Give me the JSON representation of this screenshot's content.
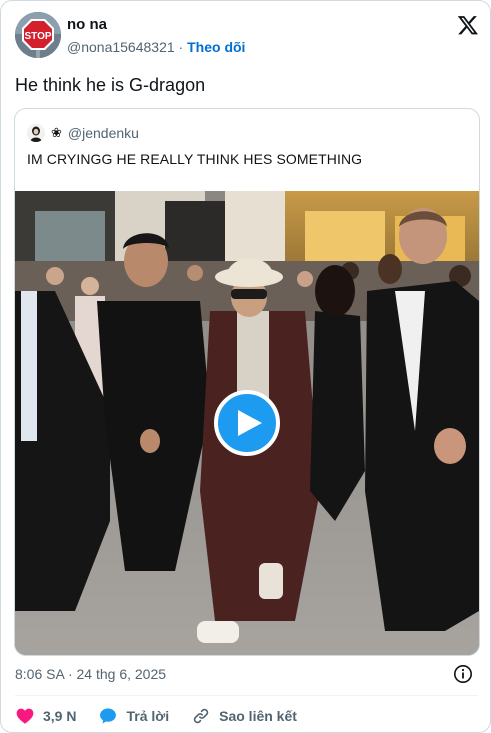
{
  "author": {
    "name": "no na",
    "handle": "@nona15648321",
    "separator": "·",
    "follow_label": "Theo dõi",
    "avatar_icon": "stop-sign-avatar",
    "avatar_text": "STOP"
  },
  "tweet": {
    "text": "He think he is G-dragon",
    "time": "8:06 SA",
    "date_separator": "·",
    "date": "24 thg 6, 2025"
  },
  "quote": {
    "flower": "❀",
    "handle": "@jendenku",
    "text": "IM CRYINGG HE REALLY THINK HES SOMETHING"
  },
  "actions": {
    "like_count": "3,9 N",
    "reply_label": "Trả lời",
    "copy_link_label": "Sao liên kết"
  },
  "colors": {
    "follow": "#006fd6",
    "like": "#f91880",
    "reply_icon": "#1d9bf0",
    "play_button": "#1d9bf0"
  },
  "icons": [
    "x-logo-icon",
    "play-icon",
    "info-icon",
    "heart-icon",
    "reply-bubble-icon",
    "link-icon"
  ]
}
